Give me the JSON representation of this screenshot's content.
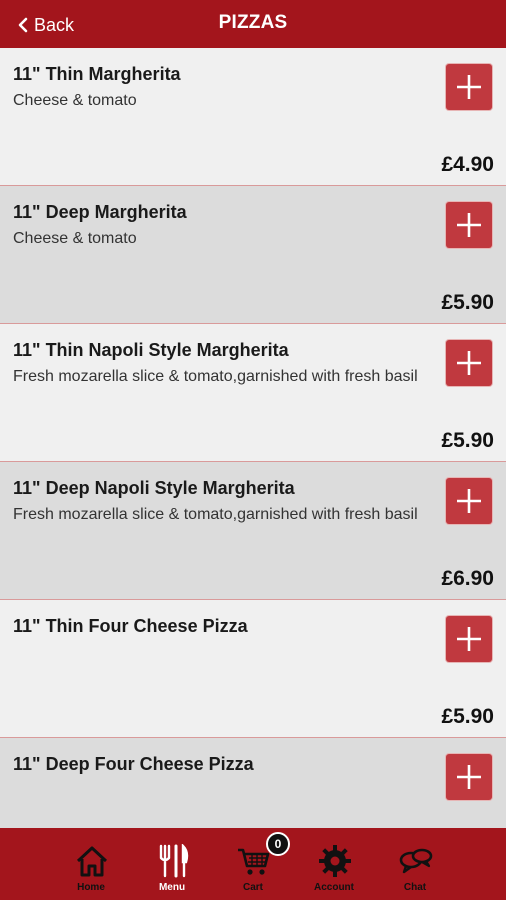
{
  "header": {
    "back_label": "Back",
    "title": "PIZZAS"
  },
  "items": [
    {
      "name": "11\" Thin Margherita",
      "description": "Cheese & tomato",
      "price": "£4.90"
    },
    {
      "name": "11\" Deep Margherita",
      "description": "Cheese & tomato",
      "price": "£5.90"
    },
    {
      "name": "11\" Thin Napoli Style Margherita",
      "description": "Fresh mozarella slice & tomato,garnished with fresh basil",
      "price": "£5.90"
    },
    {
      "name": "11\" Deep Napoli Style Margherita",
      "description": "Fresh mozarella slice & tomato,garnished with fresh basil",
      "price": "£6.90"
    },
    {
      "name": "11\" Thin Four Cheese Pizza",
      "description": "",
      "price": "£5.90"
    },
    {
      "name": "11\" Deep Four Cheese Pizza",
      "description": "",
      "price": ""
    }
  ],
  "tabbar": {
    "home": "Home",
    "menu": "Menu",
    "cart": "Cart",
    "cart_count": "0",
    "account": "Account",
    "chat": "Chat"
  },
  "colors": {
    "brand": "#a3151c",
    "add_button": "#c0393f"
  }
}
